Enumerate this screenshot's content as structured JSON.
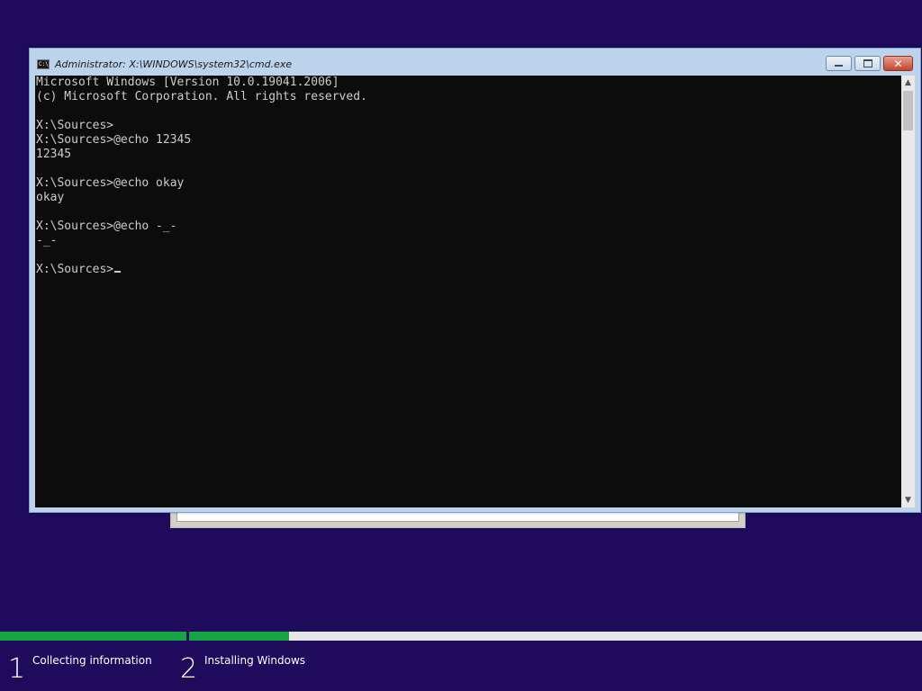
{
  "cmd_window": {
    "title": "Administrator: X:\\WINDOWS\\system32\\cmd.exe",
    "icon_text": "C:\\",
    "buttons": {
      "minimize": "–",
      "maximize": "□",
      "close": "✕"
    },
    "console": {
      "lines": [
        "Microsoft Windows [Version 10.0.19041.2006]",
        "(c) Microsoft Corporation. All rights reserved.",
        "",
        "X:\\Sources>",
        "X:\\Sources>@echo 12345",
        "12345",
        "",
        "X:\\Sources>@echo okay",
        "okay",
        "",
        "X:\\Sources>@echo -_-",
        "-_-",
        "",
        "X:\\Sources>"
      ]
    },
    "scrollbar": {
      "up_arrow": "▲",
      "down_arrow": "▼"
    }
  },
  "setup_progress": {
    "steps": [
      {
        "number": "1",
        "label": "Collecting information",
        "progress": 1.0
      },
      {
        "number": "2",
        "label": "Installing Windows",
        "progress": 0.136
      }
    ]
  },
  "colors": {
    "desktop": "#1e0b5c",
    "progress_fill": "#17a343",
    "console_bg": "#0c0c0c",
    "console_text": "#cccccc"
  }
}
